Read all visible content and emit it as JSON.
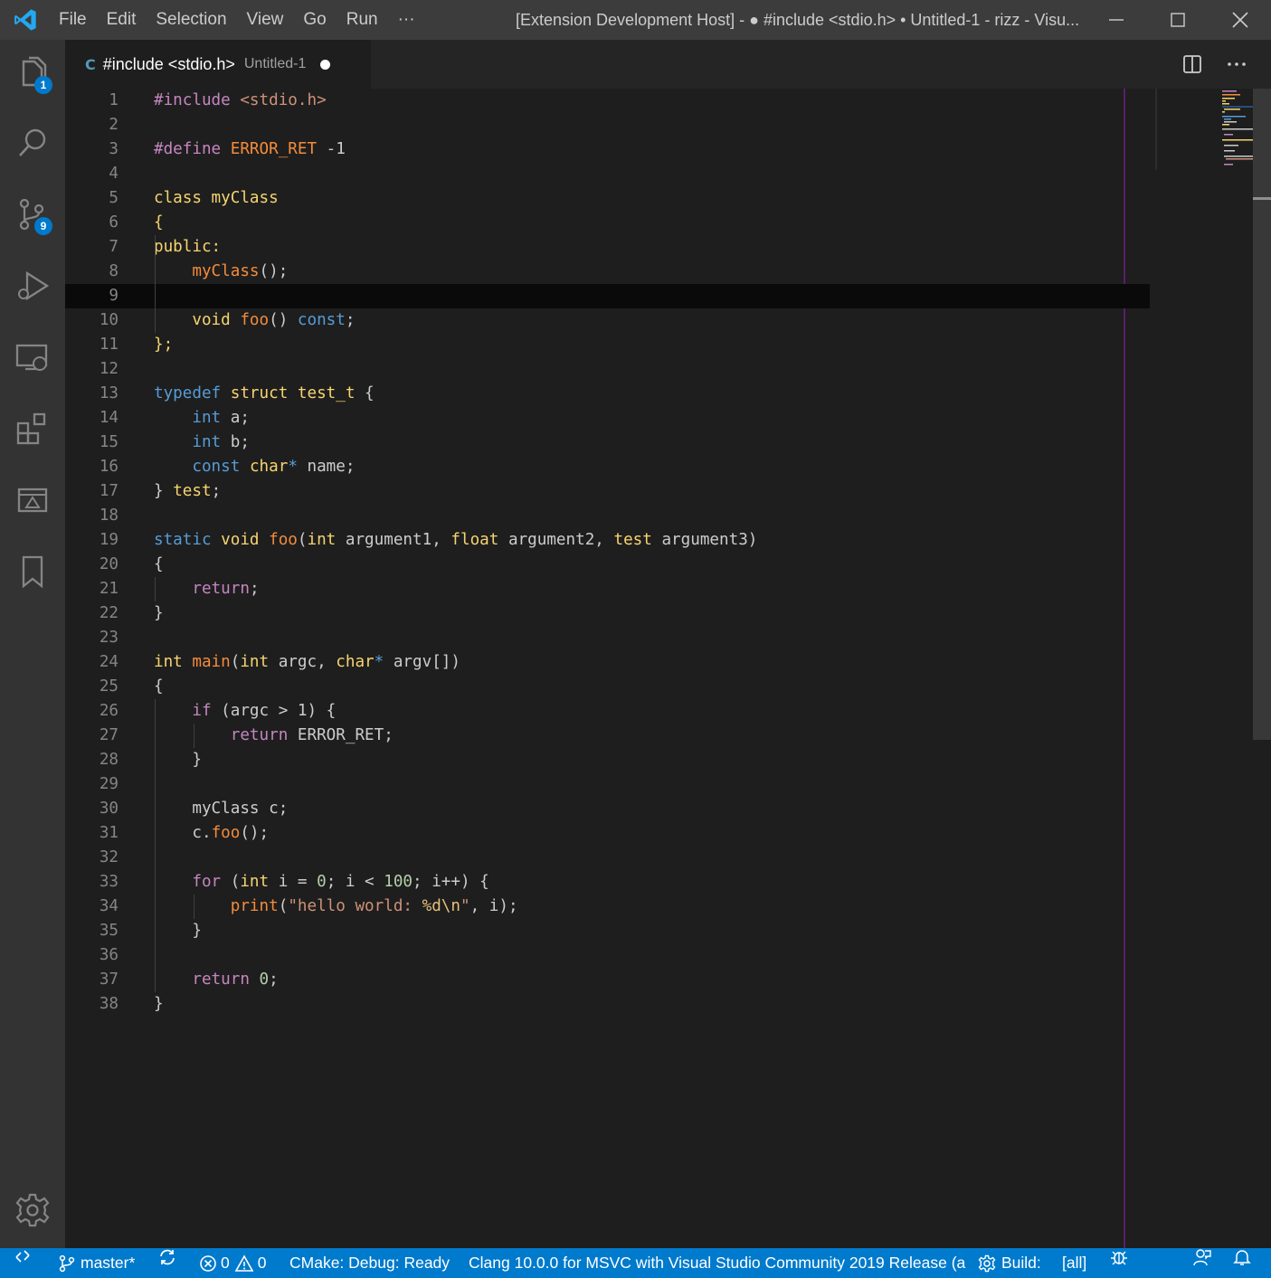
{
  "titlebar": {
    "menu": [
      "File",
      "Edit",
      "Selection",
      "View",
      "Go",
      "Run",
      "···"
    ],
    "title": "[Extension Development Host] - ● #include <stdio.h> • Untitled-1 - rizz - Visu..."
  },
  "activity": {
    "explorer_badge": "1",
    "scm_badge": "9"
  },
  "tab": {
    "title": "#include <stdio.h>",
    "description": "Untitled-1",
    "icon_glyph": "C"
  },
  "editor": {
    "line_numbers": [
      "1",
      "2",
      "3",
      "4",
      "5",
      "6",
      "7",
      "8",
      "9",
      "10",
      "11",
      "12",
      "13",
      "14",
      "15",
      "16",
      "17",
      "18",
      "19",
      "20",
      "21",
      "22",
      "23",
      "24",
      "25",
      "26",
      "27",
      "28",
      "29",
      "30",
      "31",
      "32",
      "33",
      "34",
      "35",
      "36",
      "37",
      "38"
    ],
    "current_line": 9,
    "lines": [
      [
        [
          "p",
          "#include "
        ],
        [
          "s",
          "<stdio.h>"
        ]
      ],
      [],
      [
        [
          "p",
          "#define "
        ],
        [
          "o",
          "ERROR_RET"
        ],
        [
          "t",
          " -1"
        ]
      ],
      [],
      [
        [
          "k",
          "class myClass"
        ]
      ],
      [
        [
          "k",
          "{"
        ]
      ],
      [
        [
          "k",
          "public:"
        ]
      ],
      [
        [
          "t",
          "    "
        ],
        [
          "o",
          "myClass"
        ],
        [
          "t",
          "();"
        ]
      ],
      [],
      [
        [
          "t",
          "    "
        ],
        [
          "k",
          "void "
        ],
        [
          "o",
          "foo"
        ],
        [
          "t",
          "() "
        ],
        [
          "b",
          "const"
        ],
        [
          "t",
          ";"
        ]
      ],
      [
        [
          "k",
          "};"
        ]
      ],
      [],
      [
        [
          "b",
          "typedef "
        ],
        [
          "k",
          "struct test_t "
        ],
        [
          "t",
          "{"
        ]
      ],
      [
        [
          "t",
          "    "
        ],
        [
          "b",
          "int "
        ],
        [
          "t",
          "a;"
        ]
      ],
      [
        [
          "t",
          "    "
        ],
        [
          "b",
          "int "
        ],
        [
          "t",
          "b;"
        ]
      ],
      [
        [
          "t",
          "    "
        ],
        [
          "b",
          "const "
        ],
        [
          "k",
          "char"
        ],
        [
          "b",
          "*"
        ],
        [
          "t",
          " name;"
        ]
      ],
      [
        [
          "t",
          "} "
        ],
        [
          "k",
          "test"
        ],
        [
          "t",
          ";"
        ]
      ],
      [],
      [
        [
          "b",
          "static "
        ],
        [
          "k",
          "void "
        ],
        [
          "o",
          "foo"
        ],
        [
          "t",
          "("
        ],
        [
          "k",
          "int "
        ],
        [
          "t",
          "argument1, "
        ],
        [
          "k",
          "float "
        ],
        [
          "t",
          "argument2, "
        ],
        [
          "k",
          "test "
        ],
        [
          "t",
          "argument3)"
        ]
      ],
      [
        [
          "t",
          "{"
        ]
      ],
      [
        [
          "t",
          "    "
        ],
        [
          "p",
          "return"
        ],
        [
          "t",
          ";"
        ]
      ],
      [
        [
          "t",
          "}"
        ]
      ],
      [],
      [
        [
          "k",
          "int "
        ],
        [
          "o",
          "main"
        ],
        [
          "t",
          "("
        ],
        [
          "k",
          "int "
        ],
        [
          "t",
          "argc, "
        ],
        [
          "k",
          "char"
        ],
        [
          "b",
          "*"
        ],
        [
          "t",
          " argv[])"
        ]
      ],
      [
        [
          "t",
          "{"
        ]
      ],
      [
        [
          "t",
          "    "
        ],
        [
          "p",
          "if "
        ],
        [
          "t",
          "(argc > 1) {"
        ]
      ],
      [
        [
          "t",
          "        "
        ],
        [
          "p",
          "return "
        ],
        [
          "t",
          "ERROR_RET;"
        ]
      ],
      [
        [
          "t",
          "    }"
        ]
      ],
      [],
      [
        [
          "t",
          "    myClass c;"
        ]
      ],
      [
        [
          "t",
          "    c."
        ],
        [
          "o",
          "foo"
        ],
        [
          "t",
          "();"
        ]
      ],
      [],
      [
        [
          "t",
          "    "
        ],
        [
          "p",
          "for "
        ],
        [
          "t",
          "("
        ],
        [
          "k",
          "int "
        ],
        [
          "t",
          "i = "
        ],
        [
          "n",
          "0"
        ],
        [
          "t",
          "; i < "
        ],
        [
          "n",
          "100"
        ],
        [
          "t",
          "; i++) {"
        ]
      ],
      [
        [
          "t",
          "        "
        ],
        [
          "o",
          "print"
        ],
        [
          "t",
          "("
        ],
        [
          "s",
          "\"hello world: "
        ],
        [
          "m",
          "%d\\n"
        ],
        [
          "s",
          "\""
        ],
        [
          "t",
          ", i);"
        ]
      ],
      [
        [
          "t",
          "    }"
        ]
      ],
      [],
      [
        [
          "t",
          "    "
        ],
        [
          "p",
          "return "
        ],
        [
          "n",
          "0"
        ],
        [
          "t",
          ";"
        ]
      ],
      [
        [
          "t",
          "}"
        ]
      ]
    ]
  },
  "status": {
    "branch": "master*",
    "errors": "0",
    "warnings": "0",
    "cmake": "CMake: Debug: Ready",
    "kit": "Clang 10.0.0 for MSVC with Visual Studio Community 2019 Release (a",
    "build_label": "Build:",
    "build_target": "[all]"
  },
  "colors": {
    "activity_bar": "#333333",
    "status_bar": "#007acc",
    "editor_bg": "#1e1e1e",
    "title_bar": "#3c3c3c"
  }
}
